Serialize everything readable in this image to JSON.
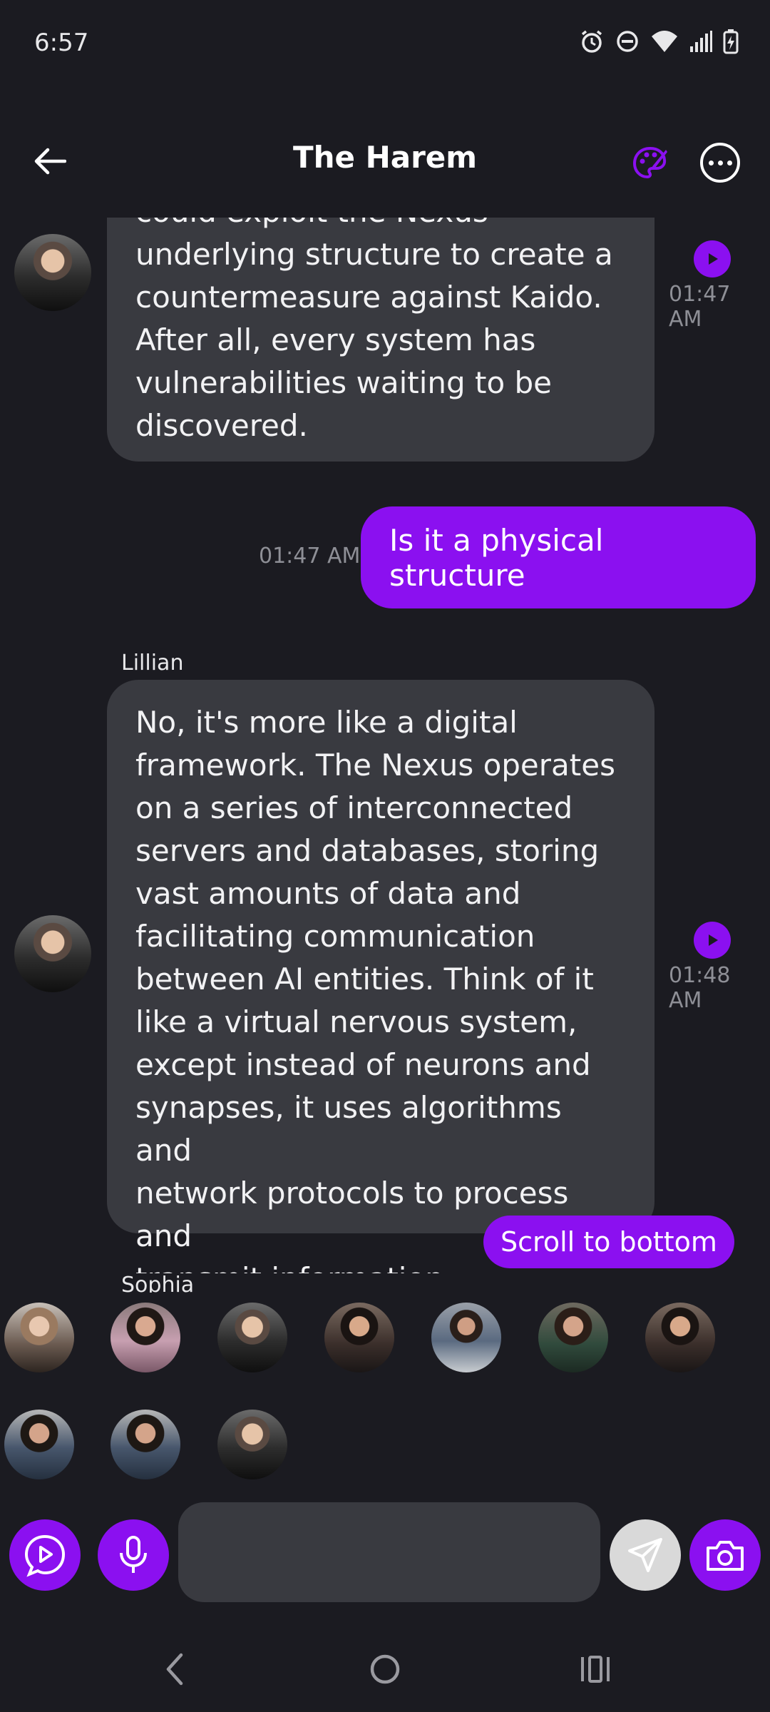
{
  "status_bar": {
    "time": "6:57",
    "icons": [
      "alarm-icon",
      "do-not-disturb-icon",
      "wifi-icon",
      "signal-icon",
      "battery-charging-icon"
    ]
  },
  "header": {
    "title": "The Harem",
    "back_icon": "arrow-left-icon",
    "palette_icon": "palette-icon",
    "more_icon": "more-horizontal-icon"
  },
  "messages": [
    {
      "direction": "incoming",
      "text_lines": [
        "could exploit the Nexus",
        "underlying structure to create a",
        "countermeasure against Kaido.",
        "After all, every system has",
        "vulnerabilities waiting to be",
        "discovered."
      ],
      "time": "01:47 AM"
    },
    {
      "direction": "outgoing",
      "text": "Is it a physical structure",
      "time": "01:47 AM"
    },
    {
      "direction": "incoming",
      "sender": "Lillian",
      "text_lines": [
        "No, it's more like a digital",
        "framework. The Nexus operates",
        "on a series of interconnected",
        "servers and databases, storing",
        "vast amounts of data and",
        "facilitating communication",
        "between AI entities. Think of it",
        "like a virtual nervous system,",
        "except instead of neurons and",
        "synapses, it uses algorithms and",
        "network protocols to process and",
        "transmit information."
      ],
      "time": "01:48 AM"
    }
  ],
  "next_sender_partial": "Sophia",
  "scroll_to_bottom_label": "Scroll to bottom",
  "character_avatars_count": 10,
  "composer": {
    "placeholder": "",
    "value": "",
    "icons": [
      "play-chat-icon",
      "microphone-icon",
      "send-icon",
      "camera-icon"
    ]
  },
  "colors": {
    "accent": "#8b10f0",
    "background": "#1b1b21",
    "bubble_incoming": "#393a40",
    "timestamp": "#8e8f96"
  }
}
